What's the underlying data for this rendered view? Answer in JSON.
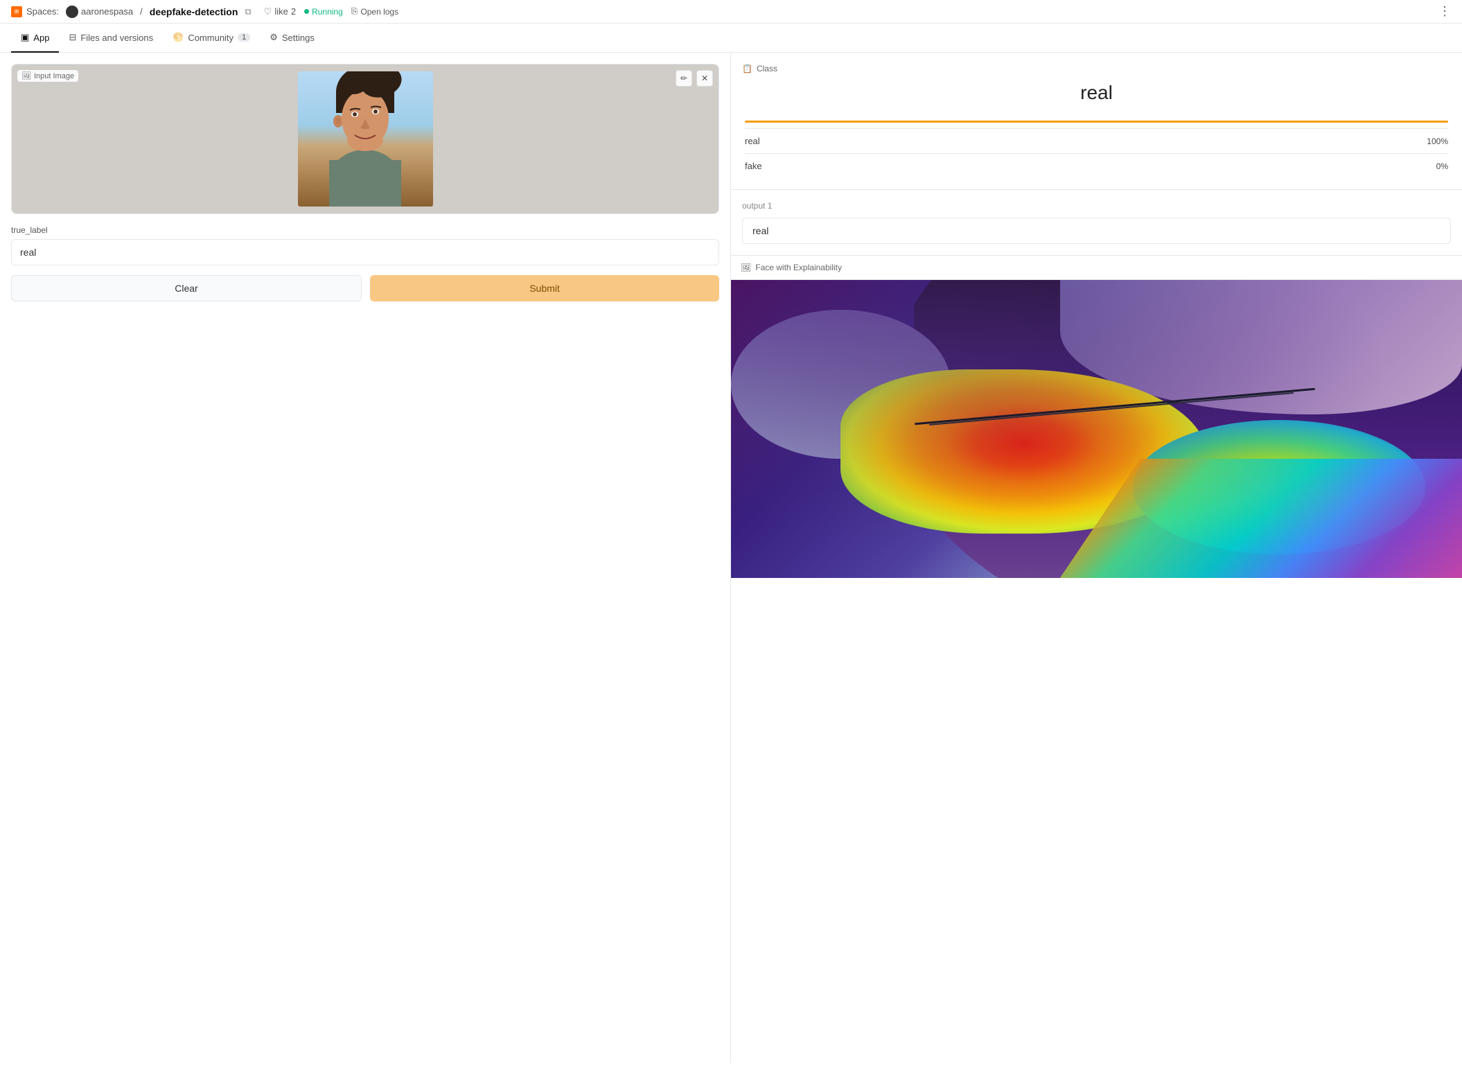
{
  "topbar": {
    "spaces_label": "Spaces:",
    "username": "aaronespasa",
    "repo_name": "deepfake-detection",
    "like_label": "like",
    "like_count": "2",
    "running_label": "Running",
    "logs_label": "Open logs"
  },
  "nav": {
    "tabs": [
      {
        "id": "app",
        "label": "App",
        "active": true,
        "badge": null
      },
      {
        "id": "files",
        "label": "Files and versions",
        "active": false,
        "badge": null
      },
      {
        "id": "community",
        "label": "Community",
        "active": false,
        "badge": "1"
      },
      {
        "id": "settings",
        "label": "Settings",
        "active": false,
        "badge": null
      }
    ]
  },
  "left": {
    "image_panel_label": "Input Image",
    "edit_icon": "✏",
    "close_icon": "×",
    "true_label_field": "true_label",
    "true_label_placeholder": "",
    "true_label_value": "real",
    "clear_button": "Clear",
    "submit_button": "Submit"
  },
  "right": {
    "class_panel_label": "Class",
    "class_value": "real",
    "labels": [
      {
        "name": "real",
        "pct": "100%",
        "fill": 100,
        "color": "real"
      },
      {
        "name": "fake",
        "pct": "0%",
        "fill": 0,
        "color": "fake"
      }
    ],
    "output_panel_label": "output 1",
    "output_value": "real",
    "explain_label": "Face with Explainability"
  }
}
